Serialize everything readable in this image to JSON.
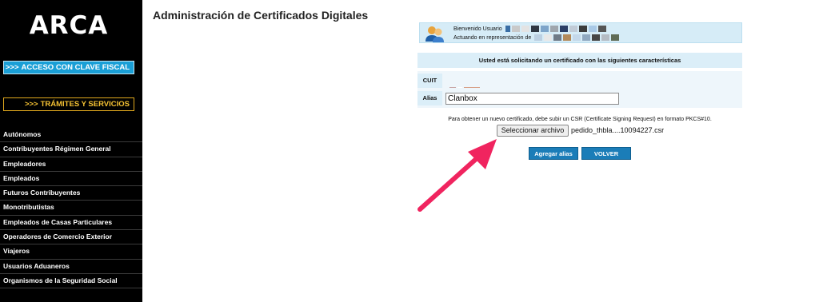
{
  "sidebar": {
    "logo": "ARCA",
    "clave_fiscal": {
      "arrows": ">>>",
      "label": "ACCESO CON CLAVE FISCAL"
    },
    "tramites": {
      "arrows": ">>>",
      "label": "TRÁMITES Y SERVICIOS"
    },
    "items": [
      {
        "label": "Autónomos"
      },
      {
        "label": "Contribuyentes Régimen General"
      },
      {
        "label": "Empleadores"
      },
      {
        "label": "Empleados"
      },
      {
        "label": "Futuros Contribuyentes"
      },
      {
        "label": "Monotributistas"
      },
      {
        "label": "Empleados de Casas Particulares"
      },
      {
        "label": "Operadores de Comercio Exterior"
      },
      {
        "label": "Viajeros"
      },
      {
        "label": "Usuarios Aduaneros"
      },
      {
        "label": "Organismos de la Seguridad Social"
      }
    ]
  },
  "main": {
    "title": "Administración de Certificados Digitales",
    "welcome": {
      "line1": "Bienvenido Usuario",
      "line2": "Actuando en representación de"
    },
    "request_header": "Usted está solicitando un certificado con las siguientes características",
    "cuit_label": "CUIT",
    "alias_label": "Alias",
    "alias_value": "Clanbox",
    "csr_instructions": "Para obtener un nuevo certificado, debe subir un CSR (Certificate Signing Request) en formato PKCS#10.",
    "file_button": "Seleccionar archivo",
    "file_name": "pedido_thbla....10094227.csr",
    "agregar_button": "Agregar alias",
    "volver_button": "VOLVER"
  },
  "colors": {
    "sidebar_bg": "#000000",
    "clave_fiscal_bg": "#1a9fd6",
    "tramites_border": "#e0a81e",
    "header_bg": "#dbeef8",
    "action_button": "#1b7db8",
    "annotation_arrow": "#f0245f"
  },
  "icons": {
    "avatar": "user-group-icon",
    "annotation": "pink-arrow-icon"
  }
}
